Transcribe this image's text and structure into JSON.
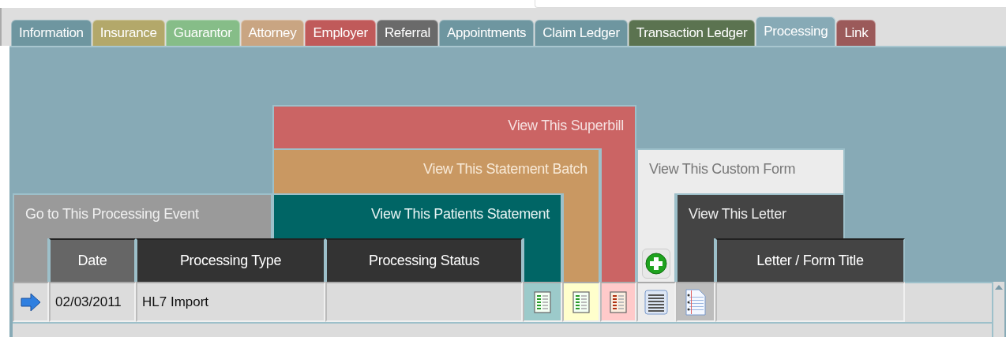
{
  "tabs": [
    {
      "label": "Information",
      "color": "#6e96a0",
      "selected": false
    },
    {
      "label": "Insurance",
      "color": "#b3a86a",
      "selected": false
    },
    {
      "label": "Guarantor",
      "color": "#86bd88",
      "selected": false
    },
    {
      "label": "Attorney",
      "color": "#c9a582",
      "selected": false
    },
    {
      "label": "Employer",
      "color": "#c05a5a",
      "selected": false
    },
    {
      "label": "Referral",
      "color": "#6a6a6a",
      "selected": false
    },
    {
      "label": "Appointments",
      "color": "#6e96a0",
      "selected": false
    },
    {
      "label": "Claim Ledger",
      "color": "#6e96a0",
      "selected": false
    },
    {
      "label": "Transaction Ledger",
      "color": "#5b7350",
      "selected": false
    },
    {
      "label": "Processing",
      "color": "#87aab6",
      "selected": true
    },
    {
      "label": "Link",
      "color": "#9b5a5a",
      "selected": false
    }
  ],
  "action_headers": {
    "superbill": "View This Superbill",
    "statement_batch": "View This Statement Batch",
    "patients_statement": "View This Patients Statement",
    "processing_event": "Go to This Processing Event",
    "custom_form": "View This Custom Form",
    "letter": "View This Letter"
  },
  "columns": {
    "date": "Date",
    "processing_type": "Processing Type",
    "processing_status": "Processing Status",
    "letter_form_title": "Letter / Form Title"
  },
  "rows": [
    {
      "date": "02/03/2011",
      "processing_type": "HL7 Import",
      "selected": false
    }
  ]
}
